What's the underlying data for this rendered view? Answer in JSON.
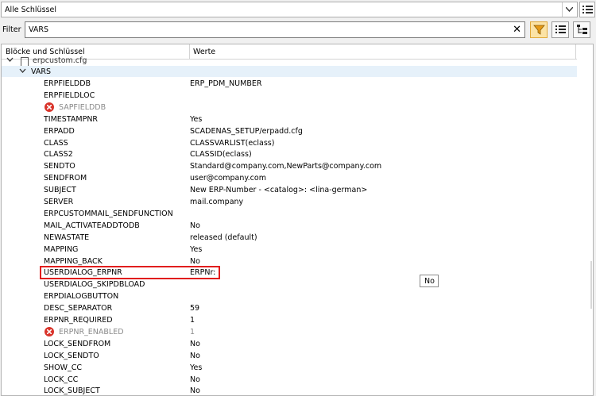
{
  "top_select": {
    "value": "Alle Schlüssel"
  },
  "filter": {
    "label": "Filter",
    "value": "VARS",
    "clear_glyph": "✕"
  },
  "toolbar": {
    "filter_icon": "funnel-icon",
    "list_icon": "list-icon",
    "tree_icon": "tree-icon"
  },
  "tree": {
    "col_keys": "Blöcke und Schlüssel",
    "col_values": "Werte",
    "file": "erpcustom.cfg",
    "block": "VARS",
    "rows": [
      {
        "k": "ERPFIELDDB",
        "v": "ERP_PDM_NUMBER",
        "err": false
      },
      {
        "k": "ERPFIELDLOC",
        "v": "",
        "err": false
      },
      {
        "k": "SAPFIELDDB",
        "v": "",
        "err": true
      },
      {
        "k": "TIMESTAMPNR",
        "v": "Yes",
        "err": false
      },
      {
        "k": "ERPADD",
        "v": "SCADENAS_SETUP/erpadd.cfg",
        "err": false
      },
      {
        "k": "CLASS",
        "v": "CLASSVARLIST(eclass)",
        "err": false
      },
      {
        "k": "CLASS2",
        "v": "CLASSID(eclass)",
        "err": false
      },
      {
        "k": "SENDTO",
        "v": "Standard@company.com,NewParts@company.com",
        "err": false
      },
      {
        "k": "SENDFROM",
        "v": "user@company.com",
        "err": false
      },
      {
        "k": "SUBJECT",
        "v": "New ERP-Number - <catalog>: <lina-german>",
        "err": false
      },
      {
        "k": "SERVER",
        "v": "mail.company",
        "err": false
      },
      {
        "k": "ERPCUSTOMMAIL_SENDFUNCTION",
        "v": "",
        "err": false
      },
      {
        "k": "MAIL_ACTIVATEADDTODB",
        "v": "No",
        "err": false
      },
      {
        "k": "NEWASTATE",
        "v": "released (default)",
        "err": false
      },
      {
        "k": "MAPPING",
        "v": "Yes",
        "err": false
      },
      {
        "k": "MAPPING_BACK",
        "v": "No",
        "err": false
      },
      {
        "k": "USERDIALOG_ERPNR",
        "v": "ERPNr:",
        "err": false
      },
      {
        "k": "USERDIALOG_SKIPDBLOAD",
        "v": "",
        "err": false
      },
      {
        "k": "ERPDIALOGBUTTON",
        "v": "",
        "err": false
      },
      {
        "k": "DESC_SEPARATOR",
        "v": "59",
        "err": false
      },
      {
        "k": "ERPNR_REQUIRED",
        "v": "1",
        "err": false
      },
      {
        "k": "ERPNR_ENABLED",
        "v": "1",
        "err": true
      },
      {
        "k": "LOCK_SENDFROM",
        "v": "No",
        "err": false
      },
      {
        "k": "LOCK_SENDTO",
        "v": "No",
        "err": false
      },
      {
        "k": "SHOW_CC",
        "v": "Yes",
        "err": false
      },
      {
        "k": "LOCK_CC",
        "v": "No",
        "err": false
      },
      {
        "k": "LOCK_SUBJECT",
        "v": "No",
        "err": false
      }
    ]
  },
  "tooltip": {
    "text": "No"
  },
  "colors": {
    "highlight": "#e11d1d",
    "selected_row": "#e6f1fa",
    "error": "#d9342b",
    "filter_active": "#fbe3a6"
  }
}
